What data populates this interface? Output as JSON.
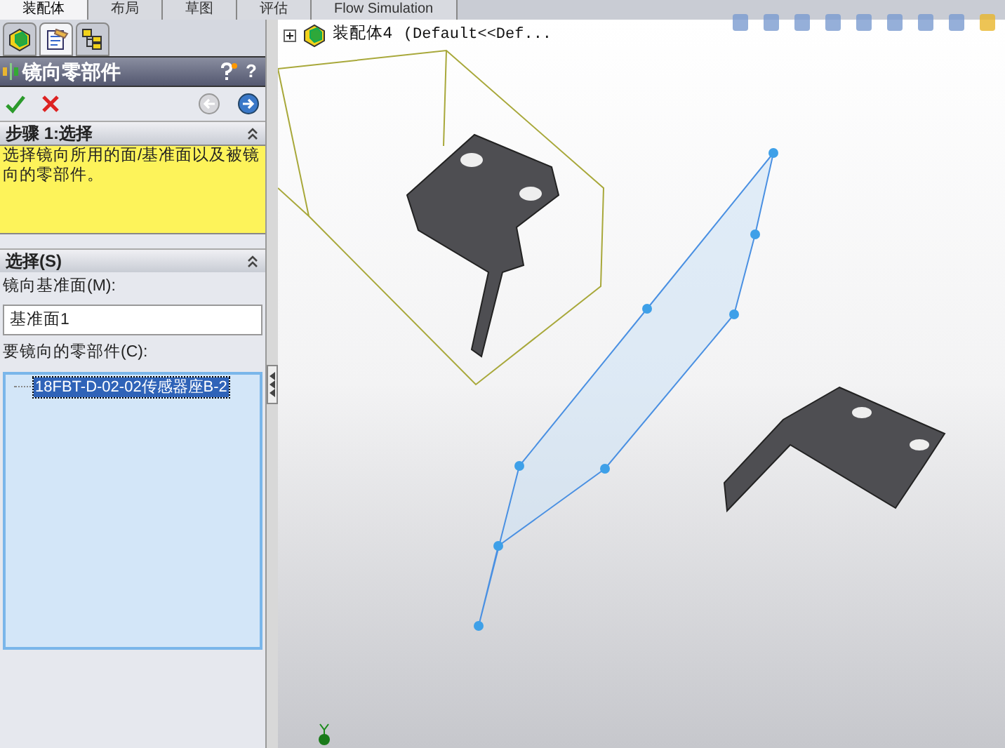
{
  "command_tabs": [
    {
      "label": "装配体",
      "selected": true
    },
    {
      "label": "布局",
      "selected": false
    },
    {
      "label": "草图",
      "selected": false
    },
    {
      "label": "评估",
      "selected": false
    },
    {
      "label": "Flow Simulation",
      "selected": false
    }
  ],
  "panel_tabs": [
    {
      "kind": "feature",
      "selected": false
    },
    {
      "kind": "property",
      "selected": true
    },
    {
      "kind": "config",
      "selected": false
    }
  ],
  "property_manager": {
    "title": "镜向零部件",
    "help": "?",
    "next_enabled": true,
    "back_enabled": false
  },
  "sections": [
    {
      "title": "步骤 1:选择",
      "expanded": true,
      "message": "选择镜向所用的面/基准面以及被镜向的零部件。"
    },
    {
      "title": "选择(S)",
      "expanded": true,
      "plane_label": "镜向基准面(M):",
      "plane_value": "基准面1",
      "components_label": "要镜向的零部件(C):",
      "components": [
        {
          "name": "18FBT-D-02-02传感器座B-2",
          "selected": true
        }
      ]
    }
  ],
  "tree": {
    "root": "装配体4",
    "config": "(Default<<Def..."
  }
}
